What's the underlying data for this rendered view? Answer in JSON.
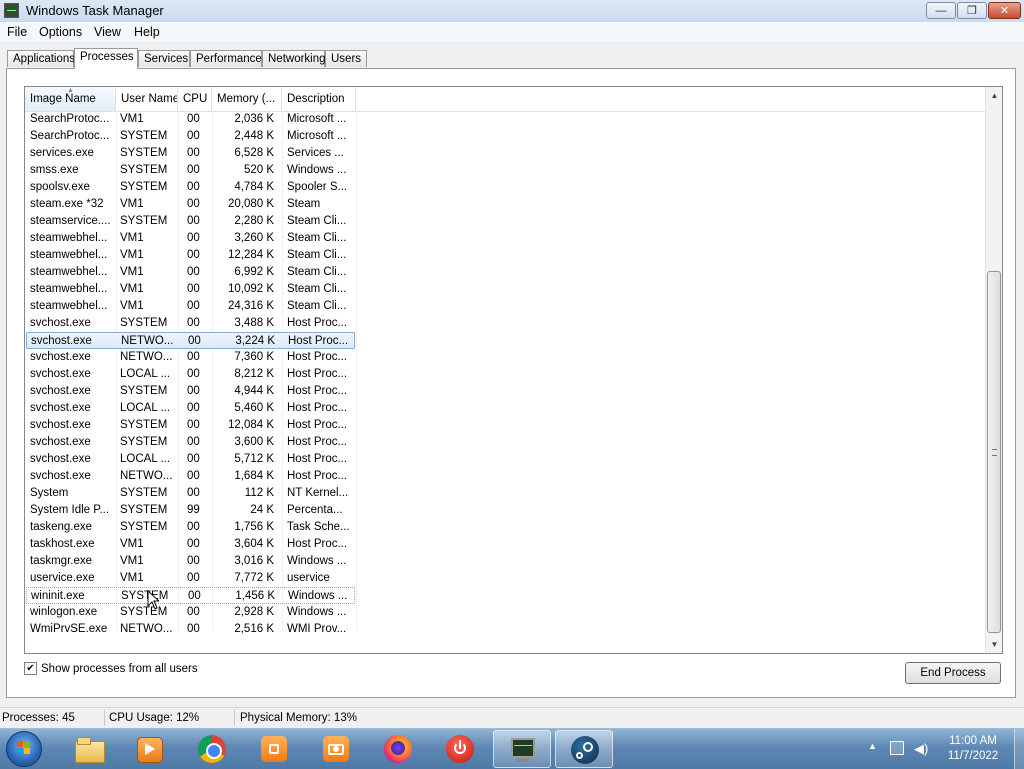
{
  "window": {
    "title": "Windows Task Manager",
    "controls": {
      "minimize": "—",
      "maximize": "❐",
      "close": "✕"
    }
  },
  "menu": [
    "File",
    "Options",
    "View",
    "Help"
  ],
  "tabs": [
    "Applications",
    "Processes",
    "Services",
    "Performance",
    "Networking",
    "Users"
  ],
  "active_tab": "Processes",
  "columns": [
    "Image Name",
    "User Name",
    "CPU",
    "Memory (...",
    "Description"
  ],
  "processes": [
    {
      "name": "SearchProtoc...",
      "user": "VM1",
      "cpu": "00",
      "mem": "2,036 K",
      "desc": "Microsoft ..."
    },
    {
      "name": "SearchProtoc...",
      "user": "SYSTEM",
      "cpu": "00",
      "mem": "2,448 K",
      "desc": "Microsoft ..."
    },
    {
      "name": "services.exe",
      "user": "SYSTEM",
      "cpu": "00",
      "mem": "6,528 K",
      "desc": "Services ..."
    },
    {
      "name": "smss.exe",
      "user": "SYSTEM",
      "cpu": "00",
      "mem": "520 K",
      "desc": "Windows ..."
    },
    {
      "name": "spoolsv.exe",
      "user": "SYSTEM",
      "cpu": "00",
      "mem": "4,784 K",
      "desc": "Spooler S..."
    },
    {
      "name": "steam.exe *32",
      "user": "VM1",
      "cpu": "00",
      "mem": "20,080 K",
      "desc": "Steam"
    },
    {
      "name": "steamservice....",
      "user": "SYSTEM",
      "cpu": "00",
      "mem": "2,280 K",
      "desc": "Steam Cli..."
    },
    {
      "name": "steamwebhel...",
      "user": "VM1",
      "cpu": "00",
      "mem": "3,260 K",
      "desc": "Steam Cli..."
    },
    {
      "name": "steamwebhel...",
      "user": "VM1",
      "cpu": "00",
      "mem": "12,284 K",
      "desc": "Steam Cli..."
    },
    {
      "name": "steamwebhel...",
      "user": "VM1",
      "cpu": "00",
      "mem": "6,992 K",
      "desc": "Steam Cli..."
    },
    {
      "name": "steamwebhel...",
      "user": "VM1",
      "cpu": "00",
      "mem": "10,092 K",
      "desc": "Steam Cli..."
    },
    {
      "name": "steamwebhel...",
      "user": "VM1",
      "cpu": "00",
      "mem": "24,316 K",
      "desc": "Steam Cli..."
    },
    {
      "name": "svchost.exe",
      "user": "SYSTEM",
      "cpu": "00",
      "mem": "3,488 K",
      "desc": "Host Proc..."
    },
    {
      "name": "svchost.exe",
      "user": "NETWO...",
      "cpu": "00",
      "mem": "3,224 K",
      "desc": "Host Proc...",
      "selected": true
    },
    {
      "name": "svchost.exe",
      "user": "NETWO...",
      "cpu": "00",
      "mem": "7,360 K",
      "desc": "Host Proc..."
    },
    {
      "name": "svchost.exe",
      "user": "LOCAL ...",
      "cpu": "00",
      "mem": "8,212 K",
      "desc": "Host Proc..."
    },
    {
      "name": "svchost.exe",
      "user": "SYSTEM",
      "cpu": "00",
      "mem": "4,944 K",
      "desc": "Host Proc..."
    },
    {
      "name": "svchost.exe",
      "user": "LOCAL ...",
      "cpu": "00",
      "mem": "5,460 K",
      "desc": "Host Proc..."
    },
    {
      "name": "svchost.exe",
      "user": "SYSTEM",
      "cpu": "00",
      "mem": "12,084 K",
      "desc": "Host Proc..."
    },
    {
      "name": "svchost.exe",
      "user": "SYSTEM",
      "cpu": "00",
      "mem": "3,600 K",
      "desc": "Host Proc..."
    },
    {
      "name": "svchost.exe",
      "user": "LOCAL ...",
      "cpu": "00",
      "mem": "5,712 K",
      "desc": "Host Proc..."
    },
    {
      "name": "svchost.exe",
      "user": "NETWO...",
      "cpu": "00",
      "mem": "1,684 K",
      "desc": "Host Proc..."
    },
    {
      "name": "System",
      "user": "SYSTEM",
      "cpu": "00",
      "mem": "112 K",
      "desc": "NT Kernel..."
    },
    {
      "name": "System Idle P...",
      "user": "SYSTEM",
      "cpu": "99",
      "mem": "24 K",
      "desc": "Percenta..."
    },
    {
      "name": "taskeng.exe",
      "user": "SYSTEM",
      "cpu": "00",
      "mem": "1,756 K",
      "desc": "Task Sche..."
    },
    {
      "name": "taskhost.exe",
      "user": "VM1",
      "cpu": "00",
      "mem": "3,604 K",
      "desc": "Host Proc..."
    },
    {
      "name": "taskmgr.exe",
      "user": "VM1",
      "cpu": "00",
      "mem": "3,016 K",
      "desc": "Windows ..."
    },
    {
      "name": "uservice.exe",
      "user": "VM1",
      "cpu": "00",
      "mem": "7,772 K",
      "desc": "uservice"
    },
    {
      "name": "wininit.exe",
      "user": "SYSTEM",
      "cpu": "00",
      "mem": "1,456 K",
      "desc": "Windows ...",
      "focused": true
    },
    {
      "name": "winlogon.exe",
      "user": "SYSTEM",
      "cpu": "00",
      "mem": "2,928 K",
      "desc": "Windows ..."
    },
    {
      "name": "WmiPrvSE.exe",
      "user": "NETWO...",
      "cpu": "00",
      "mem": "2,516 K",
      "desc": "WMI Prov..."
    }
  ],
  "show_all_users": {
    "label": "Show processes from all users",
    "checked": true
  },
  "end_process_label": "End Process",
  "status": {
    "processes": "Processes: 45",
    "cpu": "CPU Usage: 12%",
    "memory": "Physical Memory: 13%"
  },
  "taskbar": {
    "apps": [
      "file-explorer-icon",
      "media-player-icon",
      "chrome-icon",
      "app-orange-icon",
      "camera-icon",
      "firefox-icon",
      "power-icon",
      "task-manager-icon",
      "steam-icon"
    ],
    "time": "11:00 AM",
    "date": "11/7/2022"
  }
}
